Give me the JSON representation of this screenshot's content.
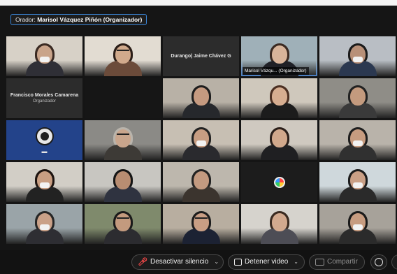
{
  "speaker": {
    "prefix": "Orador:",
    "name": "Marisol Vázquez Piñón (Organizador)"
  },
  "tiles": [
    {
      "kind": "video",
      "bg": "#d7d1c7",
      "skin": "#c9a48a",
      "hair": "#3a2a22",
      "shirt": "#2f2f36",
      "mask": true,
      "glasses": false
    },
    {
      "kind": "video",
      "bg": "#e2dcd2",
      "skin": "#d1aa8c",
      "hair": "#2b1e18",
      "shirt": "#6b4b3a",
      "mask": false,
      "glasses": true
    },
    {
      "kind": "name",
      "name": "Durango| Jaime Chávez G",
      "sub": ""
    },
    {
      "kind": "video",
      "bg": "#9fb0b8",
      "skin": "#d8b49a",
      "hair": "#3b2a22",
      "shirt": "#1f2026",
      "mask": false,
      "glasses": false,
      "active": true,
      "label": "Marisol Vázqu... (Organizador)"
    },
    {
      "kind": "video",
      "bg": "#b9bec4",
      "skin": "#b89078",
      "hair": "#1b1b1b",
      "shirt": "#2b3850",
      "mask": true,
      "glasses": false
    },
    {
      "kind": "name",
      "name": "Francisco Morales Camarena",
      "sub": "Organizador"
    },
    {
      "kind": "blank",
      "bg": "#161616"
    },
    {
      "kind": "video",
      "bg": "#b8b1a6",
      "skin": "#c59a80",
      "hair": "#1d1d1d",
      "shirt": "#26282c",
      "mask": false,
      "glasses": false
    },
    {
      "kind": "video",
      "bg": "#cfc8bc",
      "skin": "#d6ad90",
      "hair": "#4b2f22",
      "shirt": "#1c1c1c",
      "mask": false,
      "glasses": false
    },
    {
      "kind": "video",
      "bg": "#8f8d87",
      "skin": "#c39a7e",
      "hair": "#222",
      "shirt": "#3a3a3a",
      "mask": false,
      "glasses": false
    },
    {
      "kind": "obs",
      "bg": "#23438a"
    },
    {
      "kind": "video",
      "bg": "#8b8a86",
      "skin": "#c9a58c",
      "hair": "#b9b4ac",
      "shirt": "#3d3a36",
      "mask": false,
      "glasses": true
    },
    {
      "kind": "video",
      "bg": "#c7bfb3",
      "skin": "#c79d82",
      "hair": "#222",
      "shirt": "#2a2a2e",
      "mask": true,
      "glasses": false
    },
    {
      "kind": "video",
      "bg": "#cfc9c0",
      "skin": "#d1a88c",
      "hair": "#2b1f1a",
      "shirt": "#1f1f22",
      "mask": false,
      "glasses": false
    },
    {
      "kind": "video",
      "bg": "#b9b3aa",
      "skin": "#c79c80",
      "hair": "#1e1e1e",
      "shirt": "#303030",
      "mask": true,
      "glasses": false
    },
    {
      "kind": "video",
      "bg": "#d2cec6",
      "skin": "#c89e82",
      "hair": "#1d1410",
      "shirt": "#222",
      "mask": true,
      "glasses": false
    },
    {
      "kind": "video",
      "bg": "#c8c6c1",
      "skin": "#b88d72",
      "hair": "#151515",
      "shirt": "#2f3340",
      "mask": false,
      "glasses": false
    },
    {
      "kind": "video",
      "bg": "#bdb7ad",
      "skin": "#c39a80",
      "hair": "#222",
      "shirt": "#3b342e",
      "mask": false,
      "glasses": false
    },
    {
      "kind": "logo",
      "bg": "#1c1c1c"
    },
    {
      "kind": "video",
      "bg": "#cfd8dc",
      "skin": "#caa086",
      "hair": "#1c1c1c",
      "shirt": "#2a2a2a",
      "mask": true,
      "glasses": false
    },
    {
      "kind": "video",
      "bg": "#9aa4a8",
      "skin": "#caa188",
      "hair": "#262626",
      "shirt": "#2e2e33",
      "mask": true,
      "glasses": false
    },
    {
      "kind": "video",
      "bg": "#7f8a6c",
      "skin": "#c39a7e",
      "hair": "#1a1a1a",
      "shirt": "#2c2c30",
      "mask": false,
      "glasses": true
    },
    {
      "kind": "video",
      "bg": "#b8aea0",
      "skin": "#c89e84",
      "hair": "#1c1c1c",
      "shirt": "#1c2233",
      "mask": false,
      "glasses": true
    },
    {
      "kind": "video",
      "bg": "#d6d3cd",
      "skin": "#d2a98e",
      "hair": "#3a2a20",
      "shirt": "#4d4d55",
      "mask": false,
      "glasses": false
    },
    {
      "kind": "video",
      "bg": "#a7a29a",
      "skin": "#c79c80",
      "hair": "#1a1a1a",
      "shirt": "#2b2b2b",
      "mask": true,
      "glasses": false
    }
  ],
  "toolbar": {
    "mute_label": "Desactivar silencio",
    "video_label": "Detener video",
    "share_label": "Compartir"
  }
}
